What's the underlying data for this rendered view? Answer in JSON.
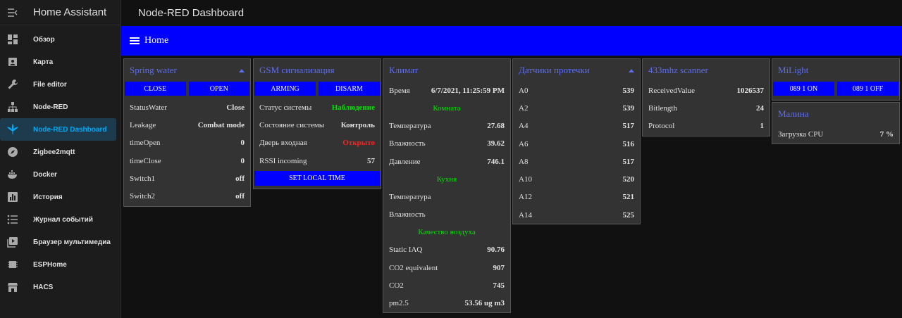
{
  "sidebar": {
    "title": "Home Assistant",
    "items": [
      {
        "label": "Обзор",
        "icon": "dashboard-icon"
      },
      {
        "label": "Карта",
        "icon": "map-icon"
      },
      {
        "label": "File editor",
        "icon": "wrench-icon"
      },
      {
        "label": "Node-RED",
        "icon": "sitemap-icon"
      },
      {
        "label": "Node-RED Dashboard",
        "icon": "cannabis-icon"
      },
      {
        "label": "Zigbee2mqtt",
        "icon": "compass-icon"
      },
      {
        "label": "Docker",
        "icon": "docker-icon"
      },
      {
        "label": "История",
        "icon": "chart-icon"
      },
      {
        "label": "Журнал событий",
        "icon": "list-icon"
      },
      {
        "label": "Браузер мультимедиа",
        "icon": "media-icon"
      },
      {
        "label": "ESPHome",
        "icon": "chip-icon"
      },
      {
        "label": "HACS",
        "icon": "store-icon"
      }
    ],
    "active_index": 4,
    "accent": "#03a9f4"
  },
  "topbar": {
    "title": "Node-RED Dashboard"
  },
  "header": {
    "title": "Home",
    "color": "#0000ff"
  },
  "cards": {
    "spring": {
      "title": "Spring water",
      "btn_close": "CLOSE",
      "btn_open": "OPEN",
      "rows": [
        {
          "label": "StatusWater",
          "value": "Close"
        },
        {
          "label": "Leakage",
          "value": "Combat mode"
        },
        {
          "label": "timeOpen",
          "value": "0"
        },
        {
          "label": "timeClose",
          "value": "0"
        },
        {
          "label": "Switch1",
          "value": "off"
        },
        {
          "label": "Switch2",
          "value": "off"
        }
      ]
    },
    "gsm": {
      "title": "GSM сигнализация",
      "btn_arm": "ARMING",
      "btn_disarm": "DISARM",
      "rows": [
        {
          "label": "Статус системы",
          "value": "Наблюдение"
        },
        {
          "label": "Состояние системы",
          "value": "Контроль"
        },
        {
          "label": "Дверь входная",
          "value": "Открыто"
        },
        {
          "label": "RSSI incoming",
          "value": "57"
        }
      ],
      "btn_time": "SET LOCAL TIME"
    },
    "climate": {
      "title": "Климат",
      "time_label": "Время",
      "time_value": "6/7/2021, 11:25:59 PM",
      "room_header": "Комната",
      "room": [
        {
          "label": "Температура",
          "value": "27.68"
        },
        {
          "label": "Влажность",
          "value": "39.62"
        },
        {
          "label": "Давление",
          "value": "746.1"
        }
      ],
      "kitchen_header": "Кухня",
      "kitchen": [
        {
          "label": "Температура",
          "value": ""
        },
        {
          "label": "Влажность",
          "value": ""
        }
      ],
      "air_header": "Качество воздуха",
      "air": [
        {
          "label": "Static IAQ",
          "value": "90.76"
        },
        {
          "label": "CO2 equivalent",
          "value": "907"
        },
        {
          "label": "CO2",
          "value": "745"
        },
        {
          "label": "pm2.5",
          "value": "53.56 ug m3"
        }
      ]
    },
    "leak": {
      "title": "Датчики протечки",
      "rows": [
        {
          "label": "A0",
          "value": "539"
        },
        {
          "label": "A2",
          "value": "539"
        },
        {
          "label": "A4",
          "value": "517"
        },
        {
          "label": "A6",
          "value": "516"
        },
        {
          "label": "A8",
          "value": "517"
        },
        {
          "label": "A10",
          "value": "520"
        },
        {
          "label": "A12",
          "value": "521"
        },
        {
          "label": "A14",
          "value": "525"
        }
      ]
    },
    "scanner": {
      "title": "433mhz scanner",
      "rows": [
        {
          "label": "ReceivedValue",
          "value": "1026537"
        },
        {
          "label": "Bitlength",
          "value": "24"
        },
        {
          "label": "Protocol",
          "value": "1"
        }
      ]
    },
    "milight": {
      "title": "MiLight",
      "btn_on": "089 1 ON",
      "btn_off": "089 1 OFF"
    },
    "malina": {
      "title": "Малина",
      "cpu_label": "Загрузка CPU",
      "cpu_value": "7 %"
    }
  },
  "colors": {
    "card_title": "#5c6df2",
    "button": "#0000ff",
    "green": "#00e000",
    "red": "#ff2020"
  }
}
